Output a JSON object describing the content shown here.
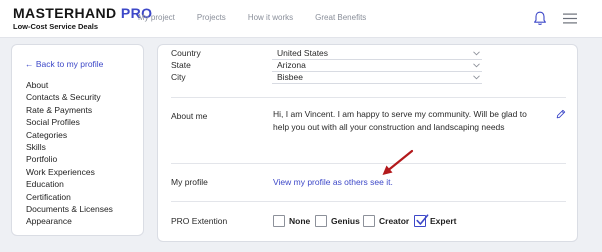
{
  "header": {
    "brand_name": "MASTERHAND",
    "brand_accent": "PRO",
    "tagline": "Low-Cost Service Deals",
    "nav": [
      "My project",
      "Projects",
      "How it works",
      "Great Benefits"
    ],
    "accent_color": "#3d48c8"
  },
  "sidebar": {
    "back_label": "← Back to my profile",
    "items": [
      "About",
      "Contacts & Security",
      "Rate & Payments",
      "Social Profiles",
      "Categories",
      "Skills",
      "Portfolio",
      "Work Experiences",
      "Education",
      "Certification",
      "Documents & Licenses",
      "Appearance"
    ]
  },
  "main": {
    "location": {
      "country_label": "Country",
      "country_value": "United States",
      "state_label": "State",
      "state_value": "Arizona",
      "city_label": "City",
      "city_value": "Bisbee"
    },
    "about": {
      "label": "About me",
      "text": "Hi, I am Vincent. I am happy to serve my community. Will be glad to help you out with all your construction and landscaping needs"
    },
    "my_profile": {
      "label": "My profile",
      "link": "View my profile as others see it."
    },
    "pro_extension": {
      "label": "PRO Extention",
      "options": [
        {
          "label": "None",
          "checked": false
        },
        {
          "label": "Genius",
          "checked": false
        },
        {
          "label": "Creator",
          "checked": false
        },
        {
          "label": "Expert",
          "checked": true
        }
      ]
    },
    "annotation_arrow_color": "#b3191c"
  }
}
